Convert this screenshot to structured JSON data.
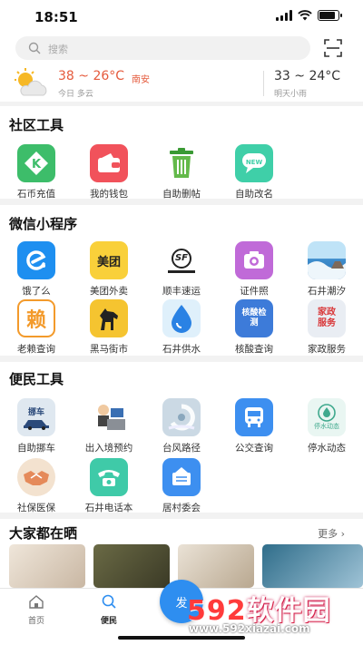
{
  "status": {
    "time": "18:51"
  },
  "search": {
    "placeholder": "搜索"
  },
  "weather": {
    "today_temp": "38 ~ 26°C",
    "city": "南安",
    "today_label": "今日 多云",
    "tomorrow_temp": "33 ~ 24°C",
    "tomorrow_label": "明天小雨"
  },
  "community": {
    "title": "社区工具",
    "items": [
      {
        "label": "石币充值",
        "icon": "k-coin-icon",
        "color": "#3dbd6a"
      },
      {
        "label": "我的钱包",
        "icon": "wallet-icon",
        "color": "#f1525b"
      },
      {
        "label": "自助删帖",
        "icon": "trash-icon",
        "color": "#4caa3a"
      },
      {
        "label": "自助改名",
        "icon": "new-badge-icon",
        "color": "#3fcfa8"
      }
    ]
  },
  "miniprograms": {
    "title": "微信小程序",
    "items": [
      {
        "label": "饿了么",
        "icon": "eleme-icon",
        "color": "#1e8ff0"
      },
      {
        "label": "美团外卖",
        "icon": "meituan-icon",
        "color": "#f9d03a",
        "mark": "美团"
      },
      {
        "label": "顺丰速运",
        "icon": "sf-express-icon",
        "color": "#222222",
        "mark": "SF"
      },
      {
        "label": "证件照",
        "icon": "camera-icon",
        "color": "#c06ad8"
      },
      {
        "label": "石井潮汐",
        "icon": "sea-icon",
        "color": "#6fb6e6"
      },
      {
        "label": "老赖查询",
        "icon": "lai-icon",
        "color": "#f39a2b",
        "mark": "赖"
      },
      {
        "label": "黑马街市",
        "icon": "horse-icon",
        "color": "#f5c430"
      },
      {
        "label": "石井供水",
        "icon": "water-drop-icon",
        "color": "#2a82e4"
      },
      {
        "label": "核酸查询",
        "icon": "nucleic-test-icon",
        "color": "#3d7bd9",
        "mark": "核酸检测"
      },
      {
        "label": "家政服务",
        "icon": "housekeeping-icon",
        "color": "#e9edf3",
        "mark": "家政服务"
      }
    ]
  },
  "civic": {
    "title": "便民工具",
    "items": [
      {
        "label": "自助挪车",
        "icon": "move-car-icon",
        "color": "#dfe8f0",
        "mark": "挪车"
      },
      {
        "label": "出入境预约",
        "icon": "immigration-icon",
        "color": "#f0d6a8"
      },
      {
        "label": "台风路径",
        "icon": "typhoon-icon",
        "color": "#cbd9e4"
      },
      {
        "label": "公交查询",
        "icon": "bus-icon",
        "color": "#3d8ff0"
      },
      {
        "label": "停水动态",
        "icon": "water-outage-icon",
        "color": "#e9f6f2",
        "mark": "停水动态"
      },
      {
        "label": "社保医保",
        "icon": "handshake-icon",
        "color": "#f3e2cf"
      },
      {
        "label": "石井电话本",
        "icon": "phone-icon",
        "color": "#3fcaa8"
      },
      {
        "label": "居村委会",
        "icon": "committee-icon",
        "color": "#3d8ff0"
      }
    ]
  },
  "feed": {
    "title": "大家都在晒",
    "more": "更多 ›"
  },
  "tabbar": {
    "home": "首页",
    "civic": "便民",
    "post": "发"
  },
  "watermark": {
    "brand_num": "592",
    "brand_text": "软件园",
    "url": "www.592xiazai.com"
  }
}
